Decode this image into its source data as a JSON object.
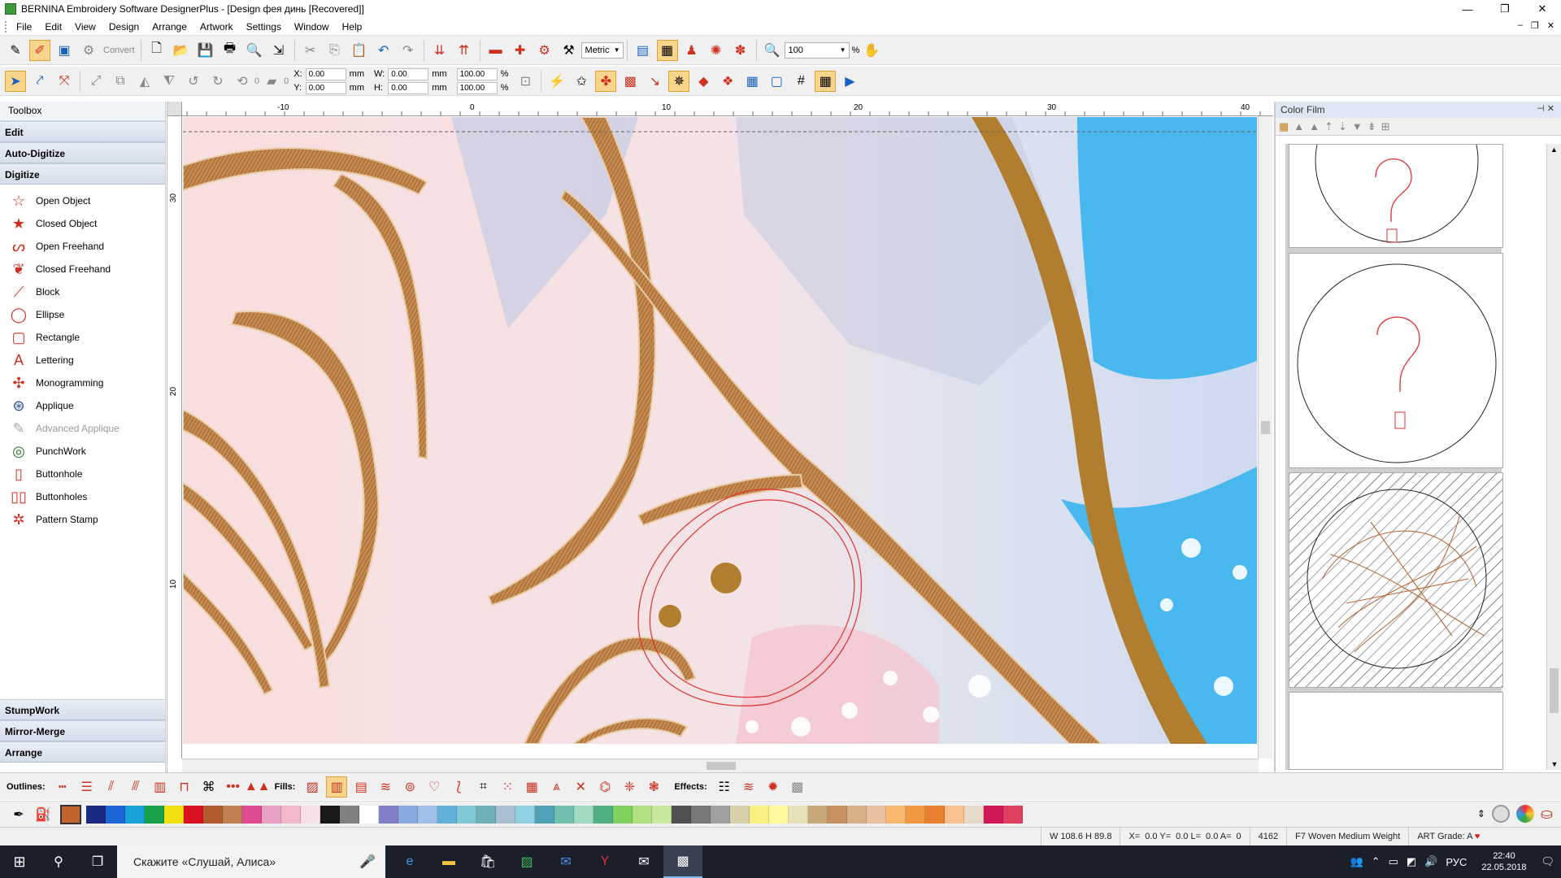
{
  "window": {
    "title": "BERNINA Embroidery Software DesignerPlus - [Design фея динь [Recovered]]",
    "min": "—",
    "restore": "❐",
    "close": "✕",
    "mdi_min": "–",
    "mdi_restore": "❐",
    "mdi_close": "✕"
  },
  "menu": [
    "File",
    "Edit",
    "View",
    "Design",
    "Arrange",
    "Artwork",
    "Settings",
    "Window",
    "Help"
  ],
  "toolbar1": {
    "convert_label": "Convert",
    "units": "Metric",
    "zoom": "100",
    "zoom_unit": "%"
  },
  "toolbar2": {
    "rotate_value": "0",
    "skew_value": "0",
    "x_label": "X:",
    "x_value": "0.00",
    "x_unit": "mm",
    "y_label": "Y:",
    "y_value": "0.00",
    "y_unit": "mm",
    "w_label": "W:",
    "w_value": "0.00",
    "w_unit": "mm",
    "h_label": "H:",
    "h_value": "0.00",
    "h_unit": "mm",
    "wpct_value": "100.00",
    "wpct_unit": "%",
    "hpct_value": "100.00",
    "hpct_unit": "%"
  },
  "toolbox": {
    "header": "Toolbox",
    "sections_top": [
      "Edit",
      "Auto-Digitize",
      "Digitize"
    ],
    "items": [
      {
        "label": "Open Object",
        "icon": "star-outline-icon",
        "glyph": "☆",
        "color": "#d03020",
        "disabled": false
      },
      {
        "label": "Closed Object",
        "icon": "star-filled-icon",
        "glyph": "★",
        "color": "#d03020",
        "disabled": false
      },
      {
        "label": "Open Freehand",
        "icon": "freehand-open-icon",
        "glyph": "ᔕ",
        "color": "#d03020",
        "disabled": false
      },
      {
        "label": "Closed Freehand",
        "icon": "freehand-closed-icon",
        "glyph": "❦",
        "color": "#d03020",
        "disabled": false
      },
      {
        "label": "Block",
        "icon": "block-icon",
        "glyph": "⟋",
        "color": "#d03020",
        "disabled": false
      },
      {
        "label": "Ellipse",
        "icon": "ellipse-icon",
        "glyph": "◯",
        "color": "#d03020",
        "disabled": false
      },
      {
        "label": "Rectangle",
        "icon": "rectangle-icon",
        "glyph": "▢",
        "color": "#d03020",
        "disabled": false
      },
      {
        "label": "Lettering",
        "icon": "lettering-icon",
        "glyph": "A",
        "color": "#d03020",
        "disabled": false
      },
      {
        "label": "Monogramming",
        "icon": "monogram-icon",
        "glyph": "✣",
        "color": "#d03020",
        "disabled": false
      },
      {
        "label": "Applique",
        "icon": "applique-icon",
        "glyph": "⊛",
        "color": "#2a4ea0",
        "disabled": false
      },
      {
        "label": "Advanced Applique",
        "icon": "advanced-applique-icon",
        "glyph": "✎",
        "color": "#aaaaaa",
        "disabled": true
      },
      {
        "label": "PunchWork",
        "icon": "punchwork-icon",
        "glyph": "◎",
        "color": "#2a7a2a",
        "disabled": false
      },
      {
        "label": "Buttonhole",
        "icon": "buttonhole-icon",
        "glyph": "▯",
        "color": "#d03020",
        "disabled": false
      },
      {
        "label": "Buttonholes",
        "icon": "buttonholes-icon",
        "glyph": "▯▯",
        "color": "#d03020",
        "disabled": false
      },
      {
        "label": "Pattern Stamp",
        "icon": "pattern-stamp-icon",
        "glyph": "✲",
        "color": "#d03020",
        "disabled": false
      }
    ],
    "sections_bottom": [
      "StumpWork",
      "Mirror-Merge",
      "Arrange"
    ]
  },
  "rulers": {
    "h_ticks": [
      "-10",
      "0",
      "10",
      "20",
      "30",
      "40"
    ],
    "v_ticks": [
      "30",
      "20",
      "10"
    ]
  },
  "color_film": {
    "title": "Color Film",
    "pin": "⊣ ✕",
    "scroll_up": "▲",
    "scroll_down": "▼"
  },
  "bottom_toolbar": {
    "outlines_label": "Outlines:",
    "fills_label": "Fills:",
    "effects_label": "Effects:"
  },
  "palette": [
    "#1a2a80",
    "#1c66d8",
    "#17a2d8",
    "#1aa04a",
    "#f0e010",
    "#d81020",
    "#b05c2c",
    "#c08050",
    "#e04a90",
    "#e8a0c0",
    "#f0b8c8",
    "#f8e0e8",
    "#181818",
    "#808080",
    "#ffffff",
    "#8080c8",
    "#88a8e0",
    "#a0c0e8",
    "#60b0d8",
    "#80c8d8",
    "#70b0b8",
    "#a8c0d0",
    "#90d0e0",
    "#50a0b8",
    "#70c0b0",
    "#a0d8c0",
    "#50b080",
    "#80d060",
    "#b0e080",
    "#c8e8a0",
    "#505050",
    "#787878",
    "#a0a0a0",
    "#d8d0a8",
    "#f8f080",
    "#fff8a0",
    "#e8e0b8",
    "#c8a878",
    "#c89060",
    "#d8b088",
    "#e8c0a0",
    "#f8b870",
    "#f09840",
    "#e88030",
    "#f8c090",
    "#e8d8c8",
    "#d01858",
    "#e04060"
  ],
  "status": {
    "size": "W 108.6 H  89.8",
    "x": "X=",
    "xval": "0.0 Y=",
    "yval": "0.0 L=",
    "lval": "0.0 A=",
    "aval": "0",
    "stitches": "4162",
    "fabric": "F7 Woven Medium Weight",
    "art": "ART Grade: A"
  },
  "taskbar": {
    "search": "Скажите «Слушай, Алиса»",
    "lang": "РУС",
    "time": "22:40",
    "date": "22.05.2018"
  }
}
